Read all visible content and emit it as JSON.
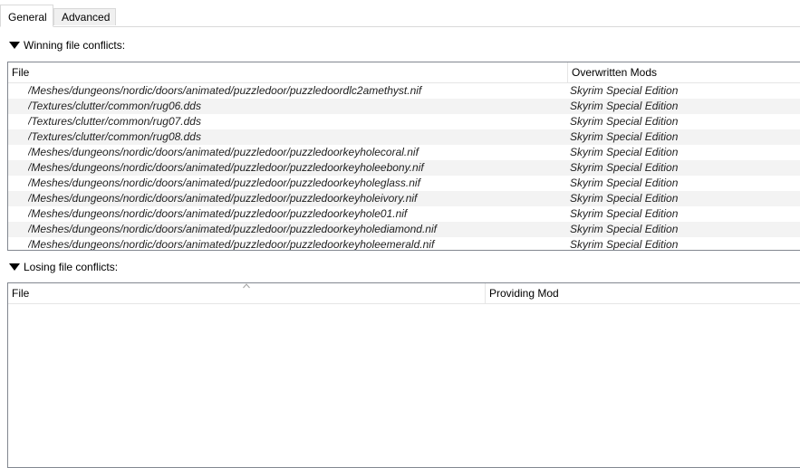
{
  "tabs": [
    {
      "label": "General"
    },
    {
      "label": "Advanced"
    }
  ],
  "winning": {
    "title": "Winning file conflicts:",
    "columns": [
      "File",
      "Overwritten Mods"
    ],
    "rows": [
      {
        "file": "/Meshes/dungeons/nordic/doors/animated/puzzledoor/puzzledoordlc2amethyst.nif",
        "mod": "Skyrim Special Edition"
      },
      {
        "file": "/Textures/clutter/common/rug06.dds",
        "mod": "Skyrim Special Edition"
      },
      {
        "file": "/Textures/clutter/common/rug07.dds",
        "mod": "Skyrim Special Edition"
      },
      {
        "file": "/Textures/clutter/common/rug08.dds",
        "mod": "Skyrim Special Edition"
      },
      {
        "file": "/Meshes/dungeons/nordic/doors/animated/puzzledoor/puzzledoorkeyholecoral.nif",
        "mod": "Skyrim Special Edition"
      },
      {
        "file": "/Meshes/dungeons/nordic/doors/animated/puzzledoor/puzzledoorkeyholeebony.nif",
        "mod": "Skyrim Special Edition"
      },
      {
        "file": "/Meshes/dungeons/nordic/doors/animated/puzzledoor/puzzledoorkeyholeglass.nif",
        "mod": "Skyrim Special Edition"
      },
      {
        "file": "/Meshes/dungeons/nordic/doors/animated/puzzledoor/puzzledoorkeyholeivory.nif",
        "mod": "Skyrim Special Edition"
      },
      {
        "file": "/Meshes/dungeons/nordic/doors/animated/puzzledoor/puzzledoorkeyhole01.nif",
        "mod": "Skyrim Special Edition"
      },
      {
        "file": "/Meshes/dungeons/nordic/doors/animated/puzzledoor/puzzledoorkeyholediamond.nif",
        "mod": "Skyrim Special Edition"
      },
      {
        "file": "/Meshes/dungeons/nordic/doors/animated/puzzledoor/puzzledoorkeyholeemerald.nif",
        "mod": "Skyrim Special Edition"
      }
    ]
  },
  "losing": {
    "title": "Losing file conflicts:",
    "columns": [
      "File",
      "Providing Mod"
    ],
    "rows": []
  }
}
